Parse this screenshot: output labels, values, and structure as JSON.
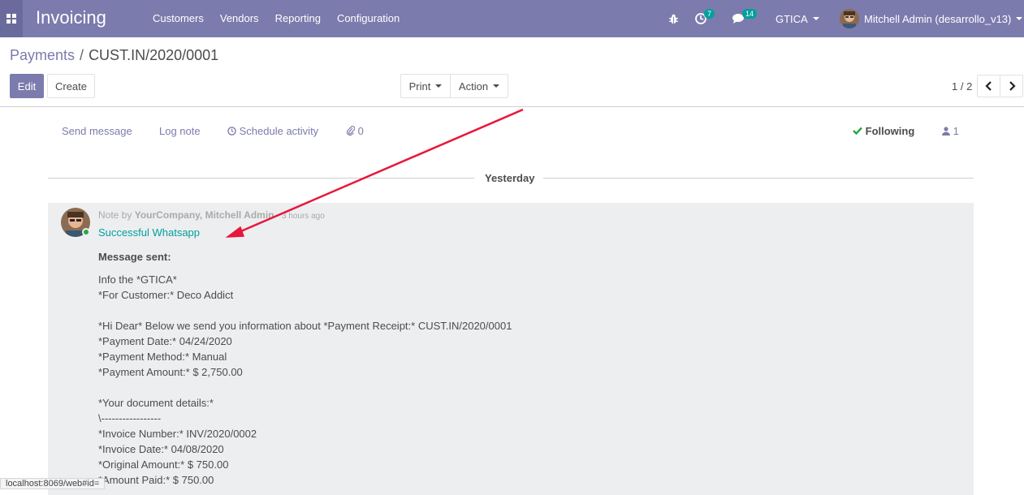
{
  "navbar": {
    "app_title": "Invoicing",
    "menu": [
      "Customers",
      "Vendors",
      "Reporting",
      "Configuration"
    ],
    "activity_count": "7",
    "message_count": "14",
    "company": "GTICA",
    "user": "Mitchell Admin (desarrollo_v13)"
  },
  "breadcrumb": {
    "parent": "Payments",
    "separator": "/",
    "current": "CUST.IN/2020/0001"
  },
  "buttons": {
    "edit": "Edit",
    "create": "Create",
    "print": "Print",
    "action": "Action"
  },
  "pager": {
    "value": "1 / 2"
  },
  "chatter": {
    "send_message": "Send message",
    "log_note": "Log note",
    "schedule_activity": "Schedule activity",
    "attachments": "0",
    "following": "Following",
    "followers": "1"
  },
  "date_separator": "Yesterday",
  "message": {
    "prefix": "Note by",
    "author": "YourCompany, Mitchell Admin",
    "time": "- 3 hours ago",
    "subject": "Successful Whatsapp",
    "body_title": "Message sent:",
    "lines": [
      "Info the *GTICA*",
      "*For Customer:* Deco Addict",
      "",
      "*Hi Dear* Below we send you information about *Payment Receipt:* CUST.IN/2020/0001",
      "*Payment Date:* 04/24/2020",
      "*Payment Method:* Manual",
      "*Payment Amount:* $ 2,750.00",
      "",
      "*Your document details:*",
      "\\-----------------",
      "*Invoice Number:* INV/2020/0002",
      "*Invoice Date:* 04/08/2020",
      "*Original Amount:* $ 750.00",
      "*Amount Paid:* $ 750.00"
    ]
  },
  "status_url": "localhost:8069/web#id=",
  "colors": {
    "brand": "#7c7bad",
    "accent": "#00a09d",
    "annotation_arrow": "#e8173a"
  },
  "icons": [
    "apps-grid-icon",
    "bug-icon",
    "activity-clock-icon",
    "chat-bubble-icon",
    "clock-icon",
    "paperclip-icon",
    "check-icon",
    "user-icon",
    "chevron-left-icon",
    "chevron-right-icon"
  ]
}
